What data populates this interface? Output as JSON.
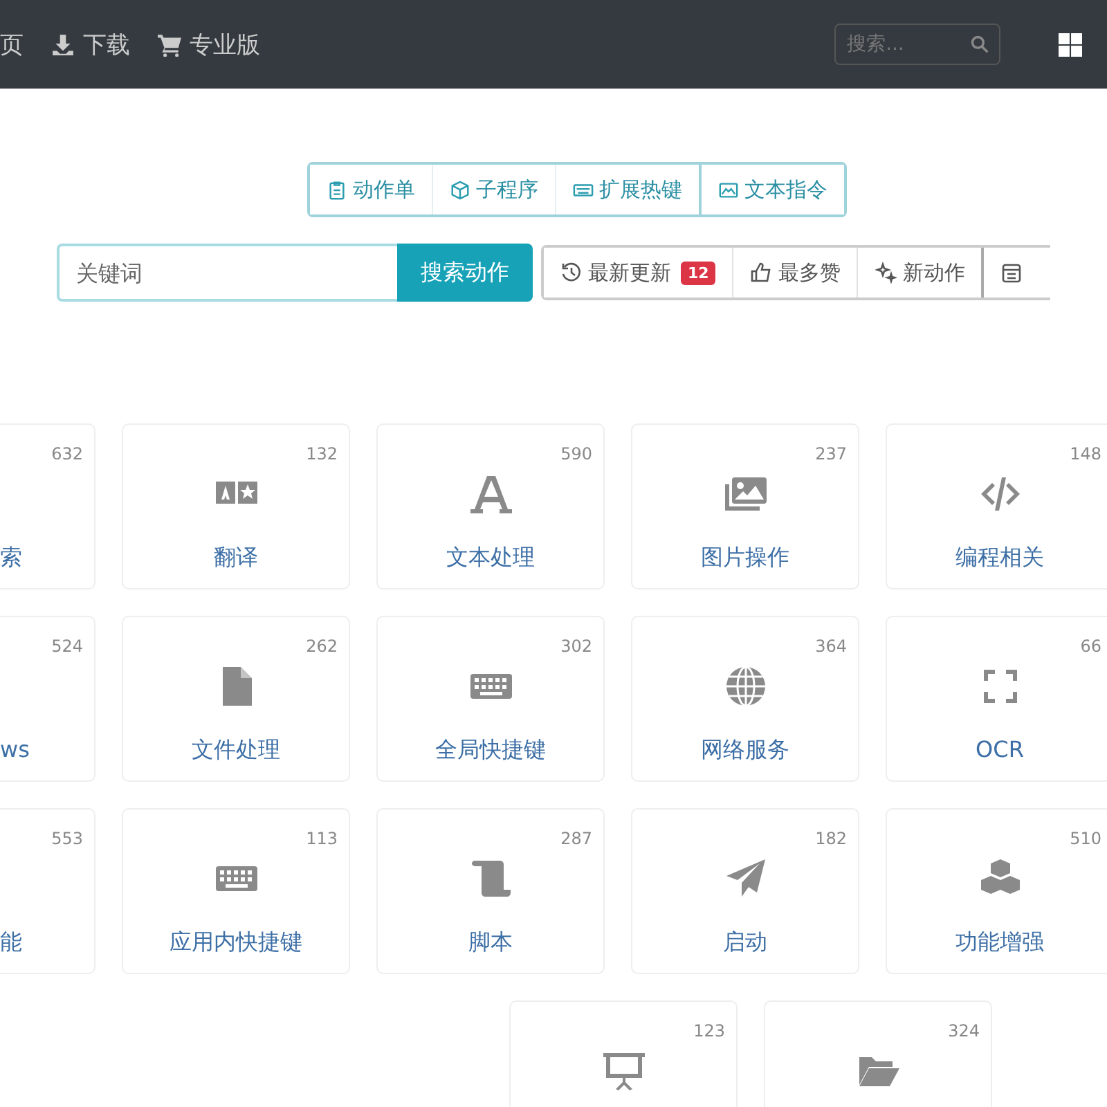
{
  "navbar": {
    "links": [
      {
        "label": "页"
      },
      {
        "label": "下载"
      },
      {
        "label": "专业版"
      }
    ],
    "search": {
      "placeholder": "搜索..."
    }
  },
  "type_tab_groups": [
    {
      "tabs": [
        {
          "label": "动作单"
        },
        {
          "label": "子程序"
        },
        {
          "label": "扩展热键"
        }
      ]
    },
    {
      "tabs": [
        {
          "label": "文本指令"
        }
      ]
    }
  ],
  "search": {
    "placeholder": "关键词",
    "button": "搜索动作"
  },
  "filters": [
    {
      "label": "最新更新",
      "badge": "12"
    },
    {
      "label": "最多赞"
    },
    {
      "label": "新动作"
    }
  ],
  "card_rows": [
    {
      "cells": [
        {
          "kind": "partial",
          "count": "632",
          "label": "索"
        },
        {
          "kind": "full",
          "count": "132",
          "label": "翻译"
        },
        {
          "kind": "full",
          "count": "590",
          "label": "文本处理"
        },
        {
          "kind": "full",
          "count": "237",
          "label": "图片操作"
        },
        {
          "kind": "full",
          "count": "148",
          "label": "编程相关"
        }
      ]
    },
    {
      "cells": [
        {
          "kind": "partial",
          "count": "524",
          "label": "ws"
        },
        {
          "kind": "full",
          "count": "262",
          "label": "文件处理"
        },
        {
          "kind": "full",
          "count": "302",
          "label": "全局快捷键"
        },
        {
          "kind": "full",
          "count": "364",
          "label": "网络服务"
        },
        {
          "kind": "full",
          "count": "66",
          "label": "OCR"
        }
      ]
    },
    {
      "cells": [
        {
          "kind": "partial",
          "count": "553",
          "label": "能"
        },
        {
          "kind": "full",
          "count": "113",
          "label": "应用内快捷键"
        },
        {
          "kind": "full",
          "count": "287",
          "label": "脚本"
        },
        {
          "kind": "full",
          "count": "182",
          "label": "启动"
        },
        {
          "kind": "full",
          "count": "510",
          "label": "功能增强"
        }
      ]
    },
    {
      "cells": [
        {
          "kind": "blank"
        },
        {
          "kind": "blank"
        },
        {
          "kind": "full",
          "count": "123"
        },
        {
          "kind": "full",
          "count": "324"
        }
      ]
    }
  ]
}
